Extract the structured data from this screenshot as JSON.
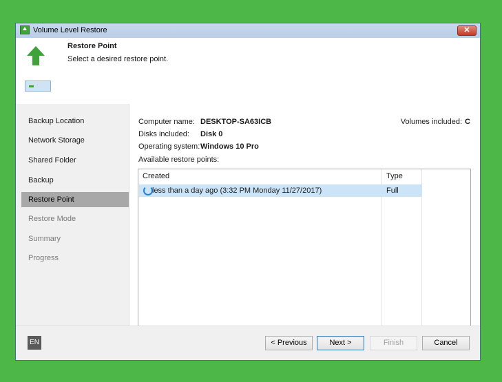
{
  "window": {
    "title": "Volume Level Restore",
    "close_label": "✕"
  },
  "header": {
    "title": "Restore Point",
    "subtitle": "Select a desired restore point."
  },
  "sidebar": {
    "items": [
      {
        "label": "Backup Location",
        "state": "normal"
      },
      {
        "label": "Network Storage",
        "state": "normal"
      },
      {
        "label": "Shared Folder",
        "state": "normal"
      },
      {
        "label": "Backup",
        "state": "normal"
      },
      {
        "label": "Restore Point",
        "state": "active"
      },
      {
        "label": "Restore Mode",
        "state": "disabled"
      },
      {
        "label": "Summary",
        "state": "disabled"
      },
      {
        "label": "Progress",
        "state": "disabled"
      }
    ]
  },
  "info": {
    "computer_label": "Computer name:",
    "computer_value": "DESKTOP-SA63ICB",
    "disks_label": "Disks included:",
    "disks_value": "Disk 0",
    "os_label": "Operating system:",
    "os_value": "Windows 10 Pro",
    "volumes_label": "Volumes included:",
    "volumes_value": "C",
    "restore_points_label": "Available restore points:"
  },
  "table": {
    "columns": [
      "Created",
      "Type"
    ],
    "rows": [
      {
        "created": "less than a day ago (3:32 PM Monday 11/27/2017)",
        "type": "Full"
      }
    ]
  },
  "footer": {
    "language": "EN",
    "previous": "< Previous",
    "next": "Next >",
    "finish": "Finish",
    "cancel": "Cancel"
  },
  "colors": {
    "background": "#4db848",
    "selection": "#cce4f7",
    "accent": "#3fa33a"
  }
}
